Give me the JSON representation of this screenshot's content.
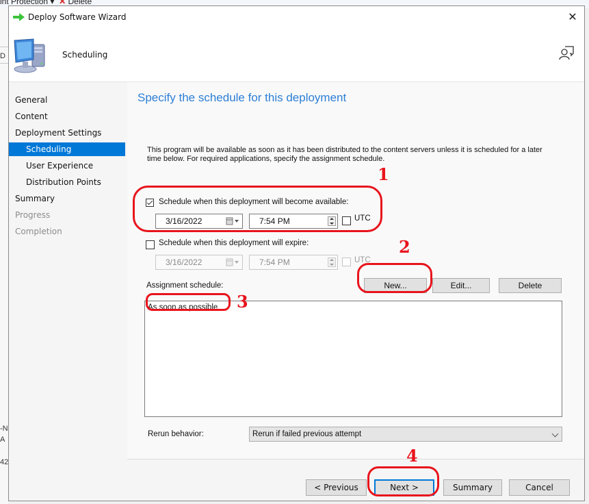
{
  "background": {
    "toolbar_fragment": "int Protection ▾",
    "toolbar_delete": "Delete",
    "left_fragments": [
      "D",
      "-N",
      "A",
      "42"
    ]
  },
  "dialog": {
    "title": "Deploy Software Wizard",
    "close_glyph": "✕",
    "header_title": "Scheduling"
  },
  "sidebar": {
    "items": [
      {
        "label": "General",
        "state": "normal"
      },
      {
        "label": "Content",
        "state": "normal"
      },
      {
        "label": "Deployment Settings",
        "state": "normal"
      },
      {
        "label": "Scheduling",
        "state": "active"
      },
      {
        "label": "User Experience",
        "state": "normal"
      },
      {
        "label": "Distribution Points",
        "state": "normal"
      },
      {
        "label": "Summary",
        "state": "normal"
      },
      {
        "label": "Progress",
        "state": "disabled"
      },
      {
        "label": "Completion",
        "state": "disabled"
      }
    ]
  },
  "main": {
    "heading": "Specify the schedule for this deployment",
    "description": "This program will be available as soon as it has been distributed to the content servers unless it is scheduled for a later time below. For required applications, specify the assignment schedule.",
    "available": {
      "checked": true,
      "label": "Schedule when this deployment will become available:",
      "date": "3/16/2022",
      "time": "7:54 PM",
      "utc_label": "UTC",
      "utc_checked": false
    },
    "expire": {
      "checked": false,
      "label": "Schedule when this deployment will expire:",
      "date": "3/16/2022",
      "time": "7:54 PM",
      "utc_label": "UTC",
      "utc_checked": false,
      "enabled": false
    },
    "assignment": {
      "label": "Assignment schedule:",
      "new_label": "New...",
      "edit_label": "Edit...",
      "delete_label": "Delete",
      "items": [
        "As soon as possible"
      ]
    },
    "rerun": {
      "label": "Rerun behavior:",
      "selected": "Rerun if failed previous attempt"
    }
  },
  "footer": {
    "previous_label": "< Previous",
    "next_label": "Next >",
    "summary_label": "Summary",
    "cancel_label": "Cancel"
  },
  "annotations": {
    "color": "#e8141c",
    "numbers": [
      "1",
      "2",
      "3",
      "4"
    ]
  },
  "colors": {
    "accent": "#0078d7",
    "heading": "#2c7fd6"
  }
}
